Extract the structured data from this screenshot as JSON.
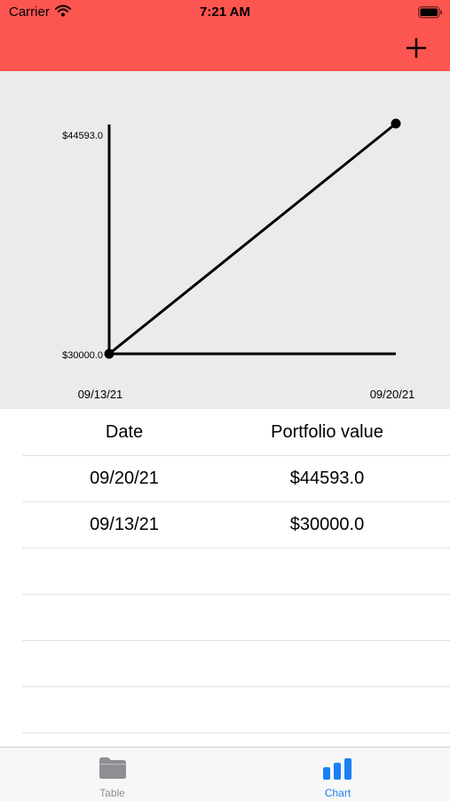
{
  "status_bar": {
    "carrier": "Carrier",
    "time": "7:21 AM"
  },
  "nav": {
    "add_icon": "plus-icon"
  },
  "chart_data": {
    "type": "line",
    "x": [
      "09/13/21",
      "09/20/21"
    ],
    "series": [
      {
        "values": [
          30000.0,
          44593.0
        ]
      }
    ],
    "y_tick_labels": [
      "$44593.0",
      "$30000.0"
    ],
    "x_tick_labels": [
      "09/13/21",
      "09/20/21"
    ],
    "ylim": [
      30000.0,
      44593.0
    ],
    "grid": false,
    "colors": {
      "line": "#000000",
      "background": "#ebebeb"
    }
  },
  "table": {
    "headers": {
      "date": "Date",
      "value": "Portfolio value"
    },
    "rows": [
      {
        "date": "09/20/21",
        "value": "$44593.0"
      },
      {
        "date": "09/13/21",
        "value": "$30000.0"
      }
    ]
  },
  "tabs": [
    {
      "label": "Table",
      "icon": "folder-icon",
      "active": false
    },
    {
      "label": "Chart",
      "icon": "bar-chart-icon",
      "active": true
    }
  ],
  "colors": {
    "header": "#fd5550",
    "tab_active": "#1a80f5",
    "tab_inactive": "#8e8e93"
  }
}
